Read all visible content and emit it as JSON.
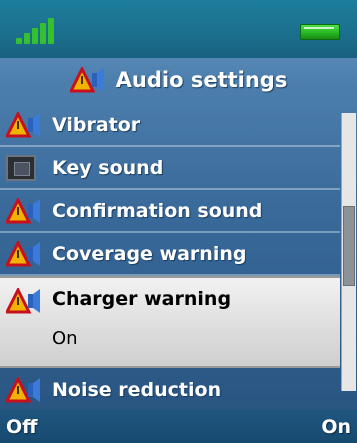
{
  "header": {
    "title": "Audio settings",
    "icon": "audio-settings-icon"
  },
  "items": [
    {
      "label": "Vibrator",
      "icon": "audio-triangle-icon"
    },
    {
      "label": "Key sound",
      "icon": "keypad-icon"
    },
    {
      "label": "Confirmation sound",
      "icon": "audio-triangle-icon"
    },
    {
      "label": "Coverage warning",
      "icon": "audio-triangle-icon"
    },
    {
      "label": "Charger warning",
      "value": "On",
      "icon": "audio-triangle-icon",
      "selected": true
    },
    {
      "label": "Noise reduction",
      "icon": "audio-triangle-icon"
    }
  ],
  "softkeys": {
    "left": "Off",
    "right": "On"
  },
  "colors": {
    "accent_green": "#35c02d",
    "selection_bg": "#dcdcdc",
    "bg_blue": "#3a6b9b"
  },
  "scroll_position_fraction": 0.47
}
